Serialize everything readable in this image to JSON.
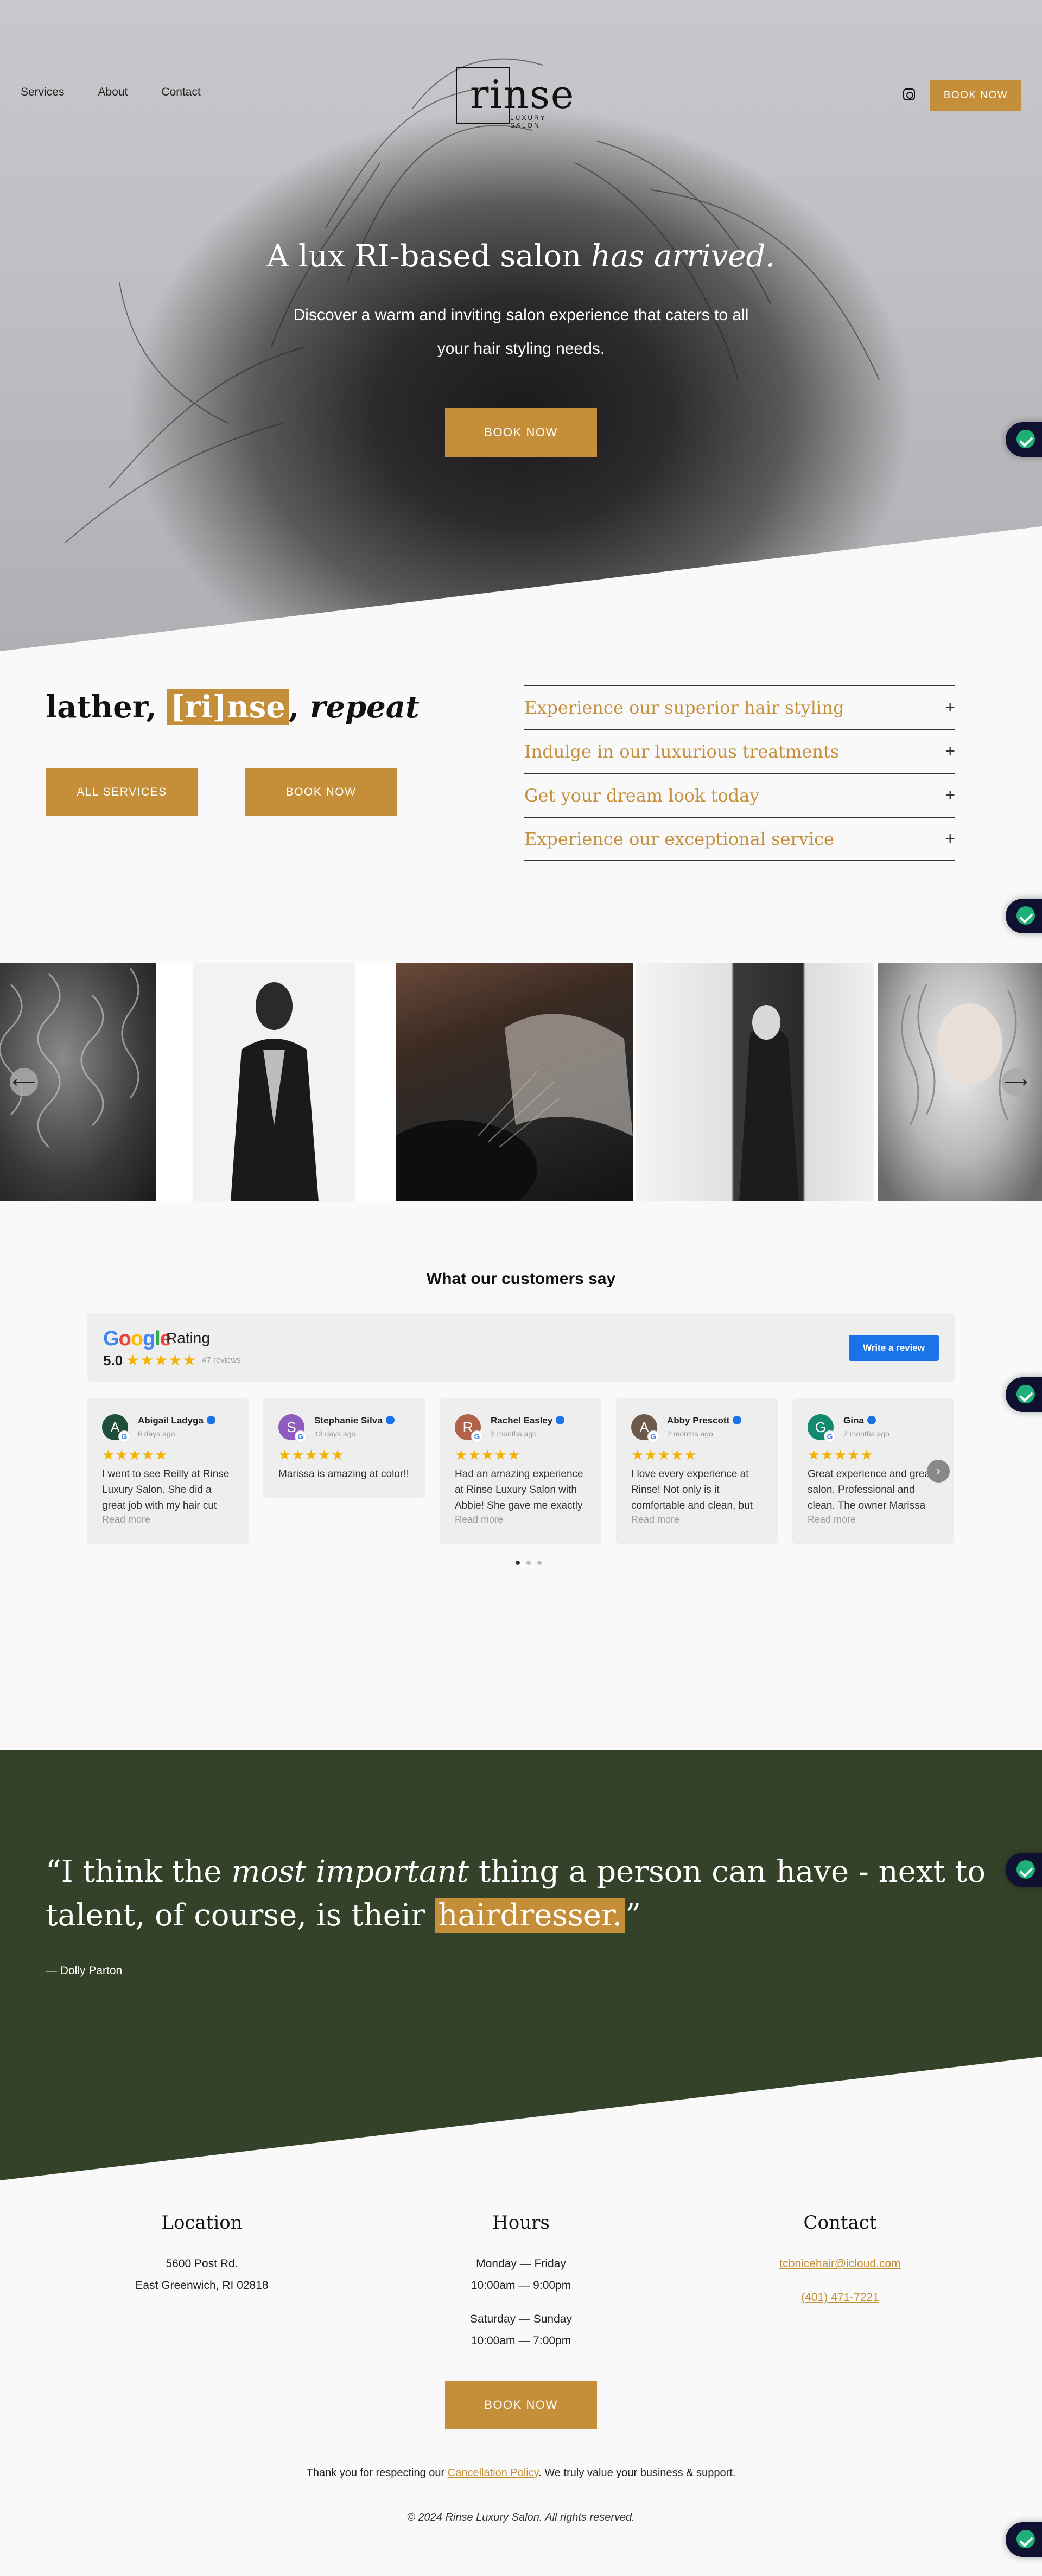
{
  "colors": {
    "accent": "#c58f3a",
    "dark_green": "#35422a",
    "page_bg": "#f9f9f9",
    "google_blue": "#1a73e8",
    "star": "#f5b100"
  },
  "nav": {
    "items": [
      "Services",
      "About",
      "Contact"
    ],
    "book_label": "BOOK NOW",
    "instagram_icon": "instagram-icon"
  },
  "logo": {
    "word": "rinse",
    "sub": "LUXURY SALON"
  },
  "hero": {
    "title_plain": "A lux RI-based salon ",
    "title_italic": "has arrived.",
    "subtitle": "Discover a warm and inviting salon experience that caters to all your hair styling needs.",
    "cta": "BOOK NOW"
  },
  "intro": {
    "tagline_a": "lather, ",
    "tagline_hl": "[ri]nse",
    "tagline_b": ", ",
    "tagline_italic": "repeat",
    "btn_services": "ALL SERVICES",
    "btn_book": "BOOK NOW",
    "accordion": [
      "Experience our superior hair styling",
      "Indulge in our luxurious treatments",
      "Get your dream look today",
      "Experience our exceptional service"
    ],
    "accordion_icon": "+"
  },
  "gallery": {
    "prev": "⟵",
    "next": "⟶"
  },
  "reviews": {
    "title": "What our customers say",
    "google_word": "Google",
    "rating_label": "Rating",
    "score": "5.0",
    "stars": "★★★★★",
    "count": "47 reviews",
    "write_btn": "Write a review",
    "read_more": "Read more",
    "next_arrow": "›",
    "cards": [
      {
        "initial": "A",
        "name": "Abigail Ladyga",
        "time": "6 days ago",
        "text": "I went to see Reilly at Rinse Luxury Salon. She did a great job with my hair cut",
        "avatar_color": "#1f4f3a",
        "more": true
      },
      {
        "initial": "S",
        "name": "Stephanie Silva",
        "time": "13 days ago",
        "text": "Marissa is amazing at color!!",
        "avatar_color": "#8e5bbf",
        "more": false
      },
      {
        "initial": "R",
        "name": "Rachel Easley",
        "time": "2 months ago",
        "text": "Had an amazing experience at Rinse Luxury Salon with Abbie! She gave me exactly",
        "avatar_color": "#b0634a",
        "more": true
      },
      {
        "initial": "A",
        "name": "Abby Prescott",
        "time": "2 months ago",
        "text": "I love every experience at Rinse! Not only is it comfortable and clean, but",
        "avatar_color": "#6e5a4a",
        "more": true
      },
      {
        "initial": "G",
        "name": "Gina",
        "time": "2 months ago",
        "text": "Great experience and great salon. Professional and clean. The owner Marissa",
        "avatar_color": "#138a6e",
        "more": true
      }
    ]
  },
  "quote": {
    "open": "“I think the ",
    "italic": "most important",
    "mid": " thing a person can have - next to talent, of course, is their ",
    "hl": "hairdresser.",
    "close": "”",
    "author": "— Dolly Parton"
  },
  "footer": {
    "location_title": "Location",
    "address_1": "5600 Post Rd.",
    "address_2": "East Greenwich, RI 02818",
    "hours_title": "Hours",
    "hours_1_days": "Monday — Friday",
    "hours_1_time": "10:00am — 9:00pm",
    "hours_2_days": "Saturday — Sunday",
    "hours_2_time": "10:00am — 7:00pm",
    "contact_title": "Contact",
    "email": "tcbnicehair@icloud.com",
    "phone": "(401) 471-7221",
    "cta": "BOOK NOW",
    "thanks_a": "Thank you for respecting our ",
    "thanks_link": "Cancellation Policy",
    "thanks_b": ". We truly value your business & support.",
    "copyright": "© 2024 Rinse Luxury Salon. All rights reserved."
  }
}
